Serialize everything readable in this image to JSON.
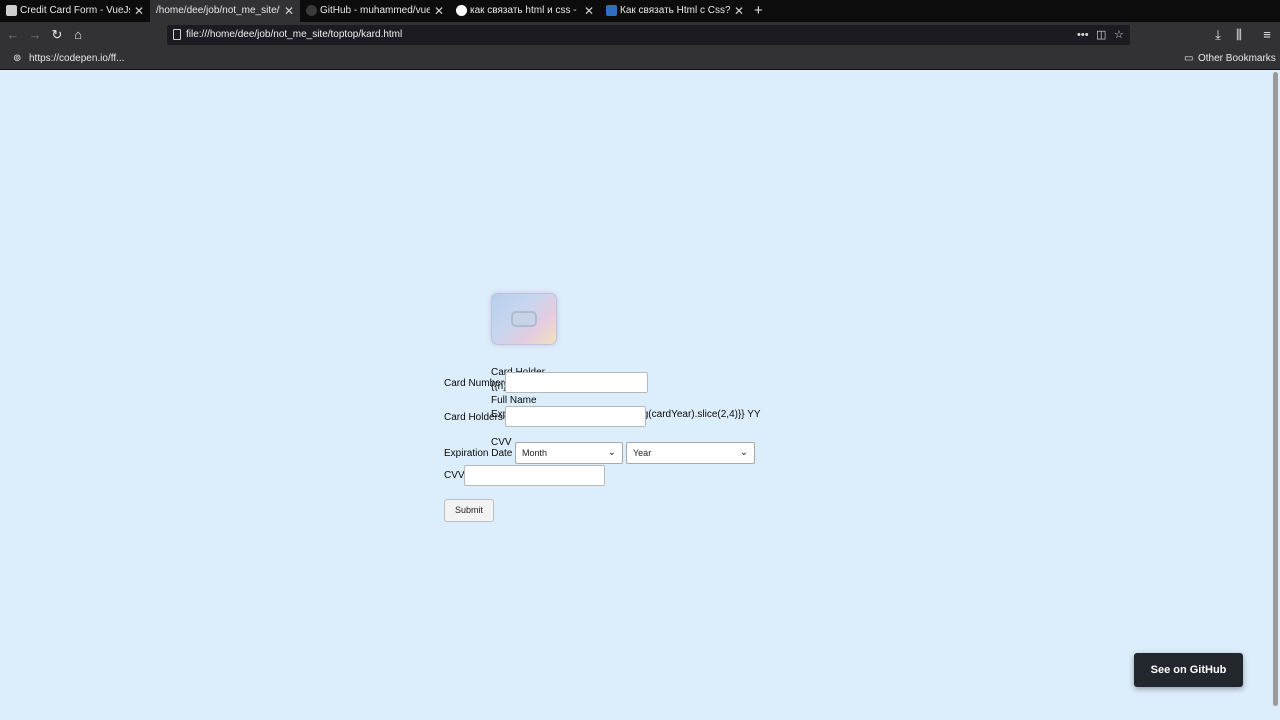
{
  "browser": {
    "tabs": [
      {
        "title": "Credit Card Form - VueJs",
        "active": false
      },
      {
        "title": "/home/dee/job/not_me_site/to",
        "active": true
      },
      {
        "title": "GitHub - muhammed/vue",
        "active": false
      },
      {
        "title": "как связать html и css - П",
        "active": false
      },
      {
        "title": "Как связать Html с Css? -",
        "active": false
      }
    ],
    "new_tab": "+",
    "url": "file:///home/dee/job/not_me_site/toptop/kard.html",
    "bookmarks": {
      "left": "https://codepen.io/ff...",
      "right": "Other Bookmarks"
    }
  },
  "card": {
    "holder_label": "Card Holder",
    "number_placeholder": "{{n}}",
    "full_name": "Full Name",
    "expires": "Expires {{cardMonth}} MM / {{String(cardYear).slice(2,4)}} YY",
    "cvv_label": "CVV"
  },
  "form": {
    "card_number_label": "Card Number",
    "card_holders_label": "Card Holders",
    "expiration_label": "Expiration Date",
    "cvv_label": "CVV",
    "month_select": "Month",
    "year_select": "Year",
    "submit": "Submit"
  },
  "github_button": "See on GitHub",
  "colors": {
    "page_bg": "#dcedfb",
    "chrome_bg": "#0c0c0d",
    "toolbar_bg": "#323234"
  }
}
